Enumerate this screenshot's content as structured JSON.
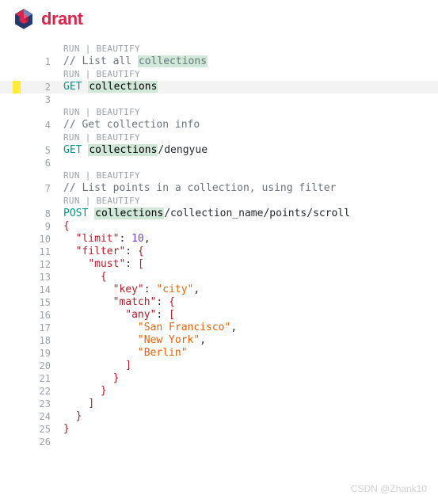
{
  "brand": {
    "name": "drant"
  },
  "annot": {
    "run": "RUN",
    "sep": " | ",
    "beautify": "BEAUTIFY"
  },
  "lines": {
    "l1_pre": "// List all ",
    "l1_hl": "collections",
    "l2_method": "GET",
    "l2_sp": " ",
    "l2_hl": "collections",
    "l4_pre": "// Get collection info",
    "l5_method": "GET",
    "l5_sp": " ",
    "l5_hl": "collections",
    "l5_rest": "/dengyue",
    "l7_pre": "// List points in a collection, using filter",
    "l8_method": "POST",
    "l8_sp": " ",
    "l8_hl": "collections",
    "l8_rest": "/collection_name/points/scroll",
    "l9": "{",
    "l10_key": "\"limit\"",
    "l10_colon": ": ",
    "l10_val": "10",
    "l10_comma": ",",
    "l11_key": "\"filter\"",
    "l11_colon": ": ",
    "l11_brace": "{",
    "l12_key": "\"must\"",
    "l12_colon": ": ",
    "l12_brack": "[",
    "l13": "{",
    "l14_key": "\"key\"",
    "l14_colon": ": ",
    "l14_val": "\"city\"",
    "l14_comma": ",",
    "l15_key": "\"match\"",
    "l15_colon": ": ",
    "l15_brace": "{",
    "l16_key": "\"any\"",
    "l16_colon": ": ",
    "l16_brack": "[",
    "l17_val": "\"San Francisco\"",
    "l17_comma": ",",
    "l18_val": "\"New York\"",
    "l18_comma": ",",
    "l19_val": "\"Berlin\"",
    "l20": "]",
    "l21": "}",
    "l22": "}",
    "l23": "]",
    "l24": "}",
    "l25": "}"
  },
  "gutter": {
    "n1": "1",
    "n2": "2",
    "n3": "3",
    "n4": "4",
    "n5": "5",
    "n6": "6",
    "n7": "7",
    "n8": "8",
    "n9": "9",
    "n10": "10",
    "n11": "11",
    "n12": "12",
    "n13": "13",
    "n14": "14",
    "n15": "15",
    "n16": "16",
    "n17": "17",
    "n18": "18",
    "n19": "19",
    "n20": "20",
    "n21": "21",
    "n22": "22",
    "n23": "23",
    "n24": "24",
    "n25": "25",
    "n26": "26"
  },
  "watermark": "CSDN @Zhank10"
}
